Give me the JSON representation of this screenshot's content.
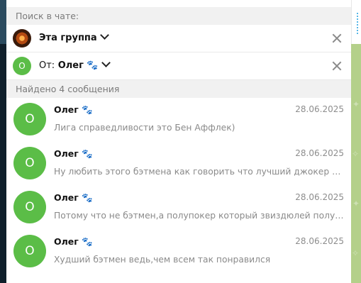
{
  "search": {
    "header": "Поиск в чате:",
    "group_filter": {
      "label": "Эта группа",
      "icon": "group-avatar-icon"
    },
    "user_filter": {
      "prefix": "От:",
      "name": "Олег 🐾",
      "avatar_letter": "О",
      "avatar_color": "#5bbd47"
    }
  },
  "results": {
    "header": "Найдено 4 сообщения",
    "items": [
      {
        "avatar_letter": "О",
        "name": "Олег 🐾",
        "date": "28.06.2025",
        "text": "Лига справедливости это Бен Аффлек)"
      },
      {
        "avatar_letter": "О",
        "name": "Олег 🐾",
        "date": "28.06.2025",
        "text": "Ну любить этого бэтмена как говорить что лучший джокер это ..."
      },
      {
        "avatar_letter": "О",
        "name": "Олег 🐾",
        "date": "28.06.2025",
        "text": "Потому что не бэтмен,а полупокер который звиздюлей получа..."
      },
      {
        "avatar_letter": "О",
        "name": "Олег 🐾",
        "date": "28.06.2025",
        "text": "Худший бэтмен ведь,чем всем так понравился"
      }
    ]
  },
  "colors": {
    "accent_green": "#5bbd47",
    "chat_background": "#b4d08a",
    "sidebar_dark": "#0f1f2b"
  }
}
